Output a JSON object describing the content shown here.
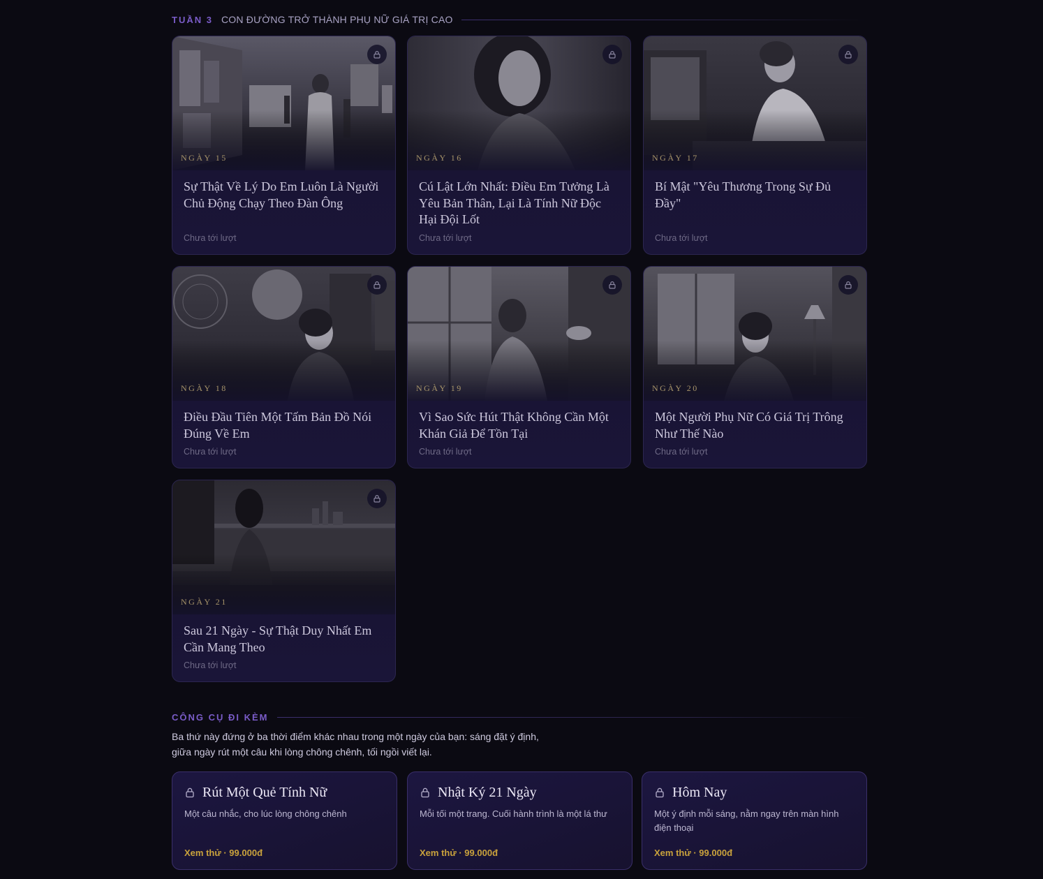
{
  "week": {
    "tag": "TUẦN 3",
    "title": "CON ĐƯỜNG TRỞ THÀNH PHỤ NỮ GIÁ TRỊ CAO"
  },
  "days": [
    {
      "day_label": "NGÀY 15",
      "title": "Sự Thật Về Lý Do Em Luôn Là Người Chủ Động Chạy Theo Đàn Ông",
      "status": "Chưa tới lượt",
      "image": "gallery-woman-photo",
      "locked": true
    },
    {
      "day_label": "NGÀY 16",
      "title": "Cú Lật Lớn Nhất: Điều Em Tưởng Là Yêu Bản Thân, Lại Là Tính Nữ Độc Hại Đội Lốt",
      "status": "Chưa tới lượt",
      "image": "woman-portrait-photo",
      "locked": true
    },
    {
      "day_label": "NGÀY 17",
      "title": "Bí Mật \"Yêu Thương Trong Sự Đủ Đầy\"",
      "status": "Chưa tới lượt",
      "image": "woman-kitchen-photo",
      "locked": true
    },
    {
      "day_label": "NGÀY 18",
      "title": "Điều Đầu Tiên Một Tấm Bản Đồ Nói Đúng Về Em",
      "status": "Chưa tới lượt",
      "image": "woman-astrology-room-photo",
      "locked": true
    },
    {
      "day_label": "NGÀY 19",
      "title": "Vì Sao Sức Hút Thật Không Cần Một Khán Giả Để Tồn Tại",
      "status": "Chưa tới lượt",
      "image": "woman-window-back-photo",
      "locked": true
    },
    {
      "day_label": "NGÀY 20",
      "title": "Một Người Phụ Nữ Có Giá Trị Trông Như Thế Nào",
      "status": "Chưa tới lượt",
      "image": "woman-window-lamp-photo",
      "locked": true
    },
    {
      "day_label": "NGÀY 21",
      "title": "Sau 21 Ngày - Sự Thật Duy Nhất Em Cần Mang Theo",
      "status": "Chưa tới lượt",
      "image": "woman-lakeside-night-photo",
      "locked": true
    }
  ],
  "tools": {
    "tag": "CÔNG CỤ ĐI KÈM",
    "description_line1": "Ba thứ này đứng ở ba thời điểm khác nhau trong một ngày của bạn: sáng đặt ý định,",
    "description_line2": "giữa ngày rút một câu khi lòng chông chênh, tối ngồi viết lại.",
    "items": [
      {
        "name": "Rút Một Quẻ Tính Nữ",
        "desc": "Một câu nhắc, cho lúc lòng chông chênh",
        "price": "Xem thử · 99.000đ"
      },
      {
        "name": "Nhật Ký 21 Ngày",
        "desc": "Mỗi tối một trang. Cuối hành trình là một lá thư",
        "price": "Xem thử · 99.000đ"
      },
      {
        "name": "Hôm Nay",
        "desc": "Một ý định mỗi sáng, nằm ngay trên màn hình điện thoại",
        "price": "Xem thử · 99.000đ"
      }
    ]
  },
  "colors": {
    "background": "#0b0a12",
    "accent_purple": "#7a5cc8",
    "gold": "#c9a23c",
    "card_border": "#2c2650"
  }
}
